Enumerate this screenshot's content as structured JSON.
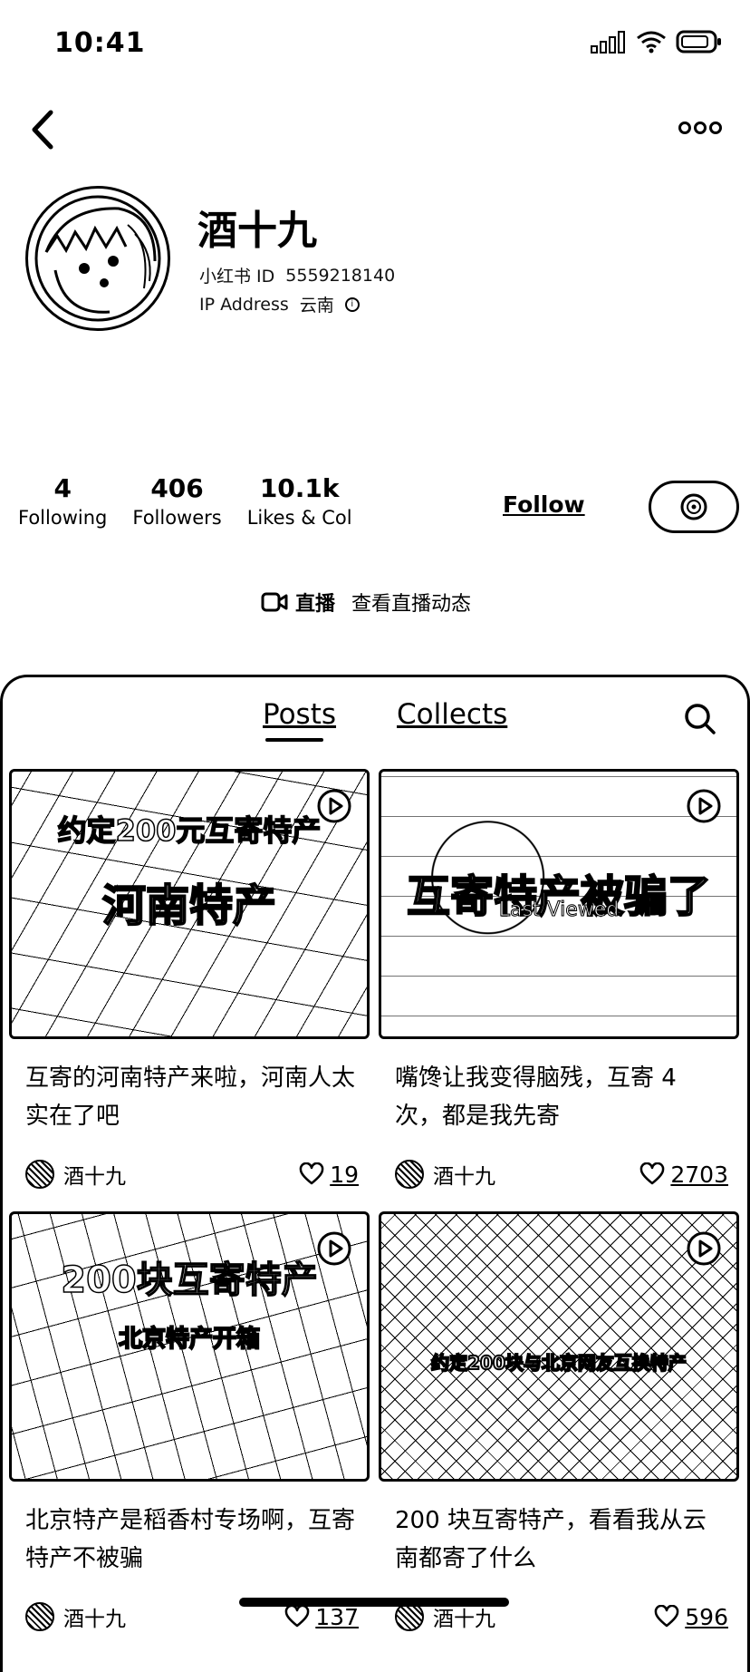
{
  "status_bar": {
    "time": "10:41"
  },
  "profile": {
    "name": "酒十九",
    "id_label": "小红书 ID",
    "id_value": "5559218140",
    "ip_label": "IP Address",
    "ip_value": "云南"
  },
  "stats": [
    {
      "value": "4",
      "label": "Following"
    },
    {
      "value": "406",
      "label": "Followers"
    },
    {
      "value": "10.1k",
      "label": "Likes & Col"
    }
  ],
  "actions": {
    "follow_label": "Follow"
  },
  "live": {
    "label": "直播",
    "text": "查看直播动态"
  },
  "tabs": {
    "posts": "Posts",
    "collects": "Collects"
  },
  "posts": [
    {
      "overlay_top": "约定200元互寄特产",
      "overlay_main": "河南特产",
      "title": "互寄的河南特产来啦，河南人太实在了吧",
      "author": "酒十九",
      "likes": "19"
    },
    {
      "overlay_main": "互寄特产被骗了",
      "badge": "Last Viewed",
      "title": "嘴馋让我变得脑残，互寄 4 次，都是我先寄",
      "author": "酒十九",
      "likes": "2703"
    },
    {
      "overlay_top": "200块互寄特产",
      "overlay_main": "北京特产开箱",
      "title": "北京特产是稻香村专场啊，互寄特产不被骗",
      "author": "酒十九",
      "likes": "137"
    },
    {
      "overlay_main": "约定200块与北京网友互换特产",
      "title": "200 块互寄特产，看看我从云南都寄了什么",
      "author": "酒十九",
      "likes": "596"
    }
  ],
  "icons": {
    "back": "chevron-left-icon",
    "more": "more-dots-icon",
    "chat": "chat-bubble-icon",
    "search": "search-icon",
    "play": "play-icon",
    "heart": "heart-icon",
    "live": "live-camera-icon"
  }
}
